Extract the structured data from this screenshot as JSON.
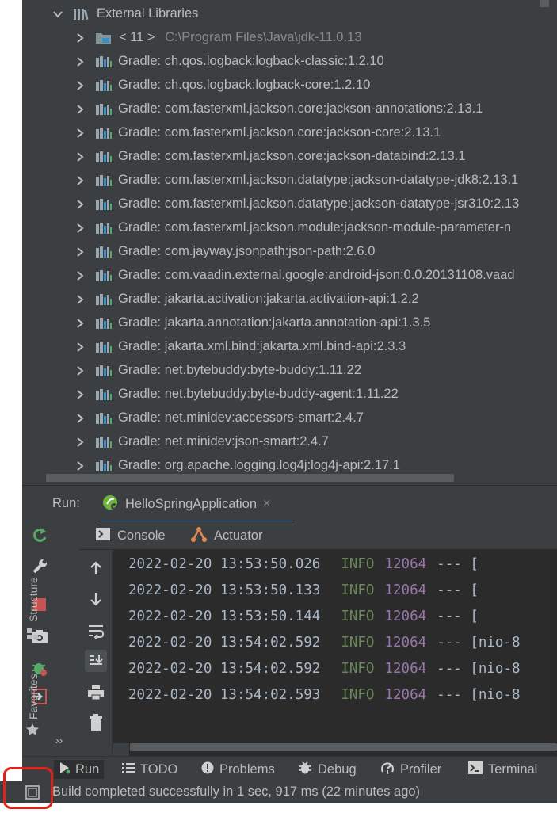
{
  "project_tree": {
    "root": {
      "label": "External Libraries"
    },
    "jdk": {
      "version": "< 11 >",
      "path": "C:\\Program Files\\Java\\jdk-11.0.13"
    },
    "libraries": [
      "Gradle: ch.qos.logback:logback-classic:1.2.10",
      "Gradle: ch.qos.logback:logback-core:1.2.10",
      "Gradle: com.fasterxml.jackson.core:jackson-annotations:2.13.1",
      "Gradle: com.fasterxml.jackson.core:jackson-core:2.13.1",
      "Gradle: com.fasterxml.jackson.core:jackson-databind:2.13.1",
      "Gradle: com.fasterxml.jackson.datatype:jackson-datatype-jdk8:2.13.1",
      "Gradle: com.fasterxml.jackson.datatype:jackson-datatype-jsr310:2.13",
      "Gradle: com.fasterxml.jackson.module:jackson-module-parameter-n",
      "Gradle: com.jayway.jsonpath:json-path:2.6.0",
      "Gradle: com.vaadin.external.google:android-json:0.0.20131108.vaad",
      "Gradle: jakarta.activation:jakarta.activation-api:1.2.2",
      "Gradle: jakarta.annotation:jakarta.annotation-api:1.3.5",
      "Gradle: jakarta.xml.bind:jakarta.xml.bind-api:2.3.3",
      "Gradle: net.bytebuddy:byte-buddy:1.11.22",
      "Gradle: net.bytebuddy:byte-buddy-agent:1.11.22",
      "Gradle: net.minidev:accessors-smart:2.4.7",
      "Gradle: net.minidev:json-smart:2.4.7",
      "Gradle: org.apache.logging.log4j:log4j-api:2.17.1"
    ]
  },
  "run_window": {
    "title": "Run:",
    "config_tab": "HelloSpringApplication",
    "close_glyph": "×",
    "subtabs": {
      "console": "Console",
      "actuator": "Actuator"
    }
  },
  "console": {
    "lines": [
      {
        "timestamp": "2022-02-20 13:53:50.026",
        "level": "INFO",
        "pid": "12064",
        "rest": "--- ["
      },
      {
        "timestamp": "2022-02-20 13:53:50.133",
        "level": "INFO",
        "pid": "12064",
        "rest": "--- ["
      },
      {
        "timestamp": "2022-02-20 13:53:50.144",
        "level": "INFO",
        "pid": "12064",
        "rest": "--- ["
      },
      {
        "timestamp": "2022-02-20 13:54:02.592",
        "level": "INFO",
        "pid": "12064",
        "rest": "--- [nio-8"
      },
      {
        "timestamp": "2022-02-20 13:54:02.592",
        "level": "INFO",
        "pid": "12064",
        "rest": "--- [nio-8"
      },
      {
        "timestamp": "2022-02-20 13:54:02.593",
        "level": "INFO",
        "pid": "12064",
        "rest": "--- [nio-8"
      }
    ]
  },
  "side_stripes": {
    "structure": "Structure",
    "favorites": "Favorites",
    "more": "››"
  },
  "bottom_bar": {
    "tabs": [
      "Run",
      "TODO",
      "Problems",
      "Debug",
      "Profiler",
      "Terminal"
    ]
  },
  "status_bar": {
    "message": "Build completed successfully in 1 sec, 917 ms (22 minutes ago)"
  },
  "colors": {
    "panel": "#3c3f41",
    "console_bg": "#2b2b2b",
    "text": "#bbbbbb",
    "info": "#6a8759",
    "pid": "#9876aa",
    "highlight_box": "#e0221b"
  }
}
